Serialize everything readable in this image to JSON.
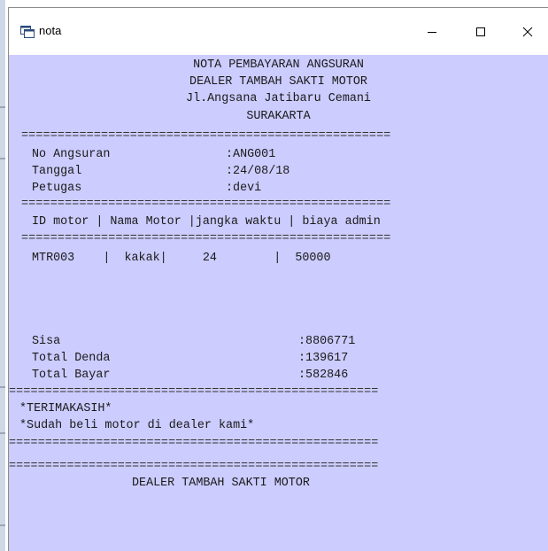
{
  "window": {
    "title": "nota",
    "controls": {
      "minimize": "minimize-icon",
      "maximize": "maximize-icon",
      "close": "close-icon"
    }
  },
  "header": {
    "line1": "NOTA PEMBAYARAN ANGSURAN",
    "line2": "DEALER TAMBAH SAKTI MOTOR",
    "line3": "Jl.Angsana Jatibaru Cemani",
    "line4": "SURAKARTA"
  },
  "separator": "===================================================",
  "info": {
    "no_angsuran_label": "No Angsuran",
    "no_angsuran_value": ":ANG001",
    "tanggal_label": "Tanggal",
    "tanggal_value": ":24/08/18",
    "petugas_label": "Petugas",
    "petugas_value": ":devi"
  },
  "table": {
    "header": "ID motor | Nama Motor |jangka waktu | biaya admin",
    "row": "MTR003    |  kakak|     24        |  50000"
  },
  "totals": {
    "sisa_label": "Sisa",
    "sisa_value": ":8806771",
    "denda_label": "Total Denda",
    "denda_value": ":139617",
    "bayar_label": "Total Bayar",
    "bayar_value": ":582846"
  },
  "footer": {
    "thanks": "*TERIMAKASIH*",
    "message": "*Sudah beli motor di dealer kami*",
    "dealer": "DEALER TAMBAH SAKTI MOTOR"
  },
  "colors": {
    "content_bg": "#ccccff",
    "titlebar_bg": "#ffffff"
  }
}
